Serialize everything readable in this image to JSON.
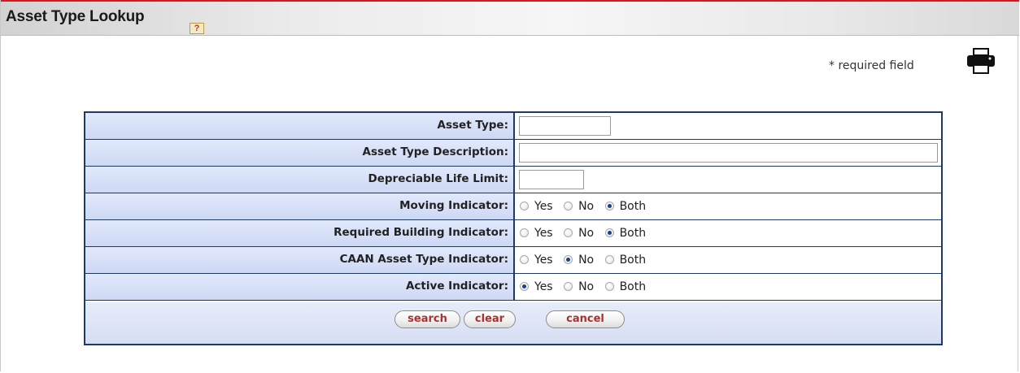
{
  "header": {
    "title": "Asset Type Lookup",
    "help_glyph": "?"
  },
  "required_note": "* required field",
  "icons": {
    "help": "help-icon",
    "print": "printer-icon"
  },
  "colors": {
    "header_accent": "#d7171f",
    "table_border": "#1e3a62",
    "label_bg": "#cdd8f4",
    "button_text": "#a8322f"
  },
  "fields": [
    {
      "label": "Asset Type:",
      "type": "text",
      "value": ""
    },
    {
      "label": "Asset Type Description:",
      "type": "text",
      "value": ""
    },
    {
      "label": "Depreciable Life Limit:",
      "type": "text",
      "value": ""
    },
    {
      "label": "Moving Indicator:",
      "type": "radio",
      "options": [
        "Yes",
        "No",
        "Both"
      ],
      "selected": "Both"
    },
    {
      "label": "Required Building Indicator:",
      "type": "radio",
      "options": [
        "Yes",
        "No",
        "Both"
      ],
      "selected": "Both"
    },
    {
      "label": "CAAN Asset Type Indicator:",
      "type": "radio",
      "options": [
        "Yes",
        "No",
        "Both"
      ],
      "selected": "No"
    },
    {
      "label": "Active Indicator:",
      "type": "radio",
      "options": [
        "Yes",
        "No",
        "Both"
      ],
      "selected": "Yes"
    }
  ],
  "buttons": {
    "search": "search",
    "clear": "clear",
    "cancel": "cancel"
  }
}
